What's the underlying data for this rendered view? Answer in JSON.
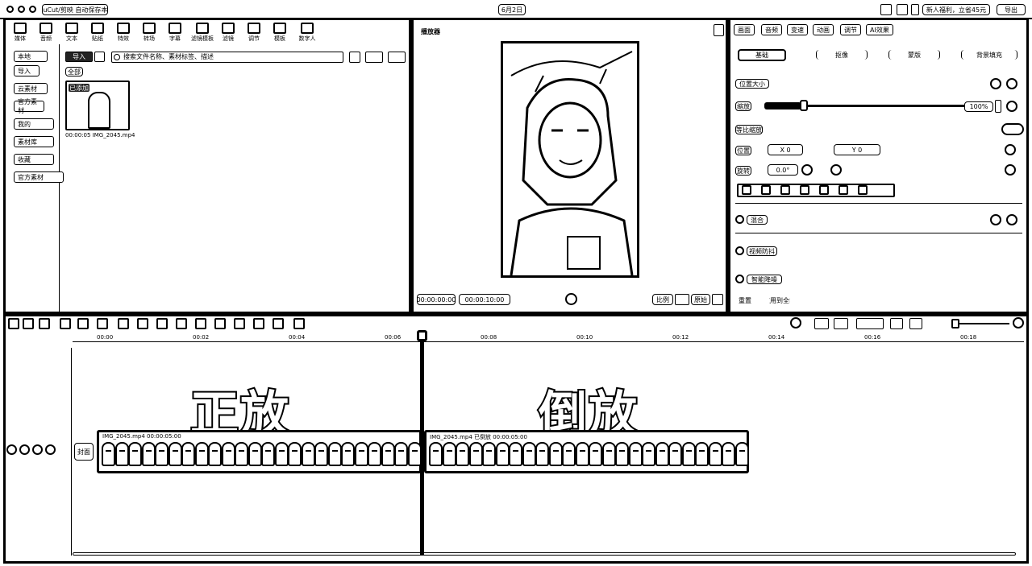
{
  "titlebar": {
    "app_name": "YouCut/剪映",
    "project_label": "自动保存本地",
    "center_title": "6月2日",
    "promo": "新人福利，立省45元",
    "export_label": "导出"
  },
  "toolbar": [
    {
      "label": "媒体",
      "icon": "media-icon"
    },
    {
      "label": "音频",
      "icon": "audio-icon"
    },
    {
      "label": "文本",
      "icon": "text-icon"
    },
    {
      "label": "贴纸",
      "icon": "sticker-icon"
    },
    {
      "label": "特效",
      "icon": "effect-icon"
    },
    {
      "label": "转场",
      "icon": "transition-icon"
    },
    {
      "label": "字幕",
      "icon": "caption-icon"
    },
    {
      "label": "滤镜模板",
      "icon": "filter-template-icon"
    },
    {
      "label": "滤镜",
      "icon": "filter-icon"
    },
    {
      "label": "调节",
      "icon": "adjust-icon"
    },
    {
      "label": "模板",
      "icon": "template-icon"
    },
    {
      "label": "数字人",
      "icon": "avatar-icon"
    }
  ],
  "media": {
    "sidebar": [
      "本地",
      "导入",
      "云素材",
      "官方素材",
      "我的",
      "素材库",
      "收藏",
      "官方素材"
    ],
    "import_label": "导入",
    "search_placeholder": "搜索文件名称、素材标签、描述",
    "filter_all": "全部",
    "clip_badge": "已添加",
    "clip_duration": "00:00:05",
    "clip_name": "IMG_2045.mp4"
  },
  "player": {
    "title": "播放器",
    "time_current": "00:00:00:00",
    "time_total": "00:00:10:00",
    "btn_ratio": "比例",
    "btn_full": "原始"
  },
  "inspector": {
    "tabs": [
      "画面",
      "音频",
      "变速",
      "动画",
      "调节",
      "AI效果"
    ],
    "subtabs": [
      "基础",
      "抠像",
      "蒙版",
      "背景填充"
    ],
    "section_position": "位置大小",
    "scale_label": "缩放",
    "scale_value": "100%",
    "uniform_label": "等比缩放",
    "position_label": "位置",
    "x_value": "0",
    "y_value": "0",
    "rotate_label": "旋转",
    "rotate_value": "0.0°",
    "blend_label": "混合",
    "stabilize_label": "视频防抖",
    "denoise_label": "智能降噪",
    "footer_left": "重置",
    "footer_right": "应用到全部"
  },
  "timeline": {
    "ruler": [
      "00:00",
      "00:02",
      "00:04",
      "00:06",
      "00:08",
      "00:10",
      "00:12",
      "00:14",
      "00:16",
      "00:18"
    ],
    "label_forward": "正放",
    "label_reverse": "倒放",
    "track_label": "封面",
    "clip1_name": "IMG_2045.mp4  00:00:05:00",
    "clip2_name": "IMG_2045.mp4  已倒放  00:00:05:00"
  }
}
